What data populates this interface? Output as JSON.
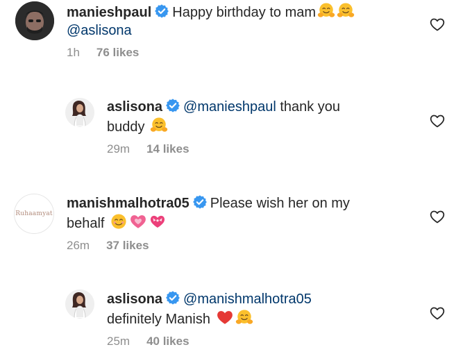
{
  "comments": [
    {
      "username": "manieshpaul",
      "text_line1": "Happy birthday to mam",
      "text_line2": "@aslisona",
      "time": "1h",
      "likes": "76 likes"
    },
    {
      "username": "aslisona",
      "mention": "@manieshpaul",
      "text_line1": "thank you",
      "text_line2": "buddy",
      "time": "29m",
      "likes": "14 likes"
    },
    {
      "username": "manishmalhotra05",
      "avatar_text": "Ruhaamyat",
      "text_line1": "Please wish her on my",
      "text_line2": "behalf",
      "time": "26m",
      "likes": "37 likes"
    },
    {
      "username": "aslisona",
      "mention": "@manishmalhotra05",
      "text_line2": "definitely Manish",
      "time": "25m",
      "likes": "40 likes"
    }
  ],
  "colors": {
    "text": "#262626",
    "mention": "#00376b",
    "muted": "#8e8e8e",
    "verified": "#3897f0"
  },
  "icons": [
    "verified-badge-icon",
    "heart-outline-icon",
    "hugging-face-emoji",
    "smiling-face-emoji",
    "growing-heart-emoji",
    "heart-with-ribbon-emoji",
    "red-heart-emoji"
  ]
}
